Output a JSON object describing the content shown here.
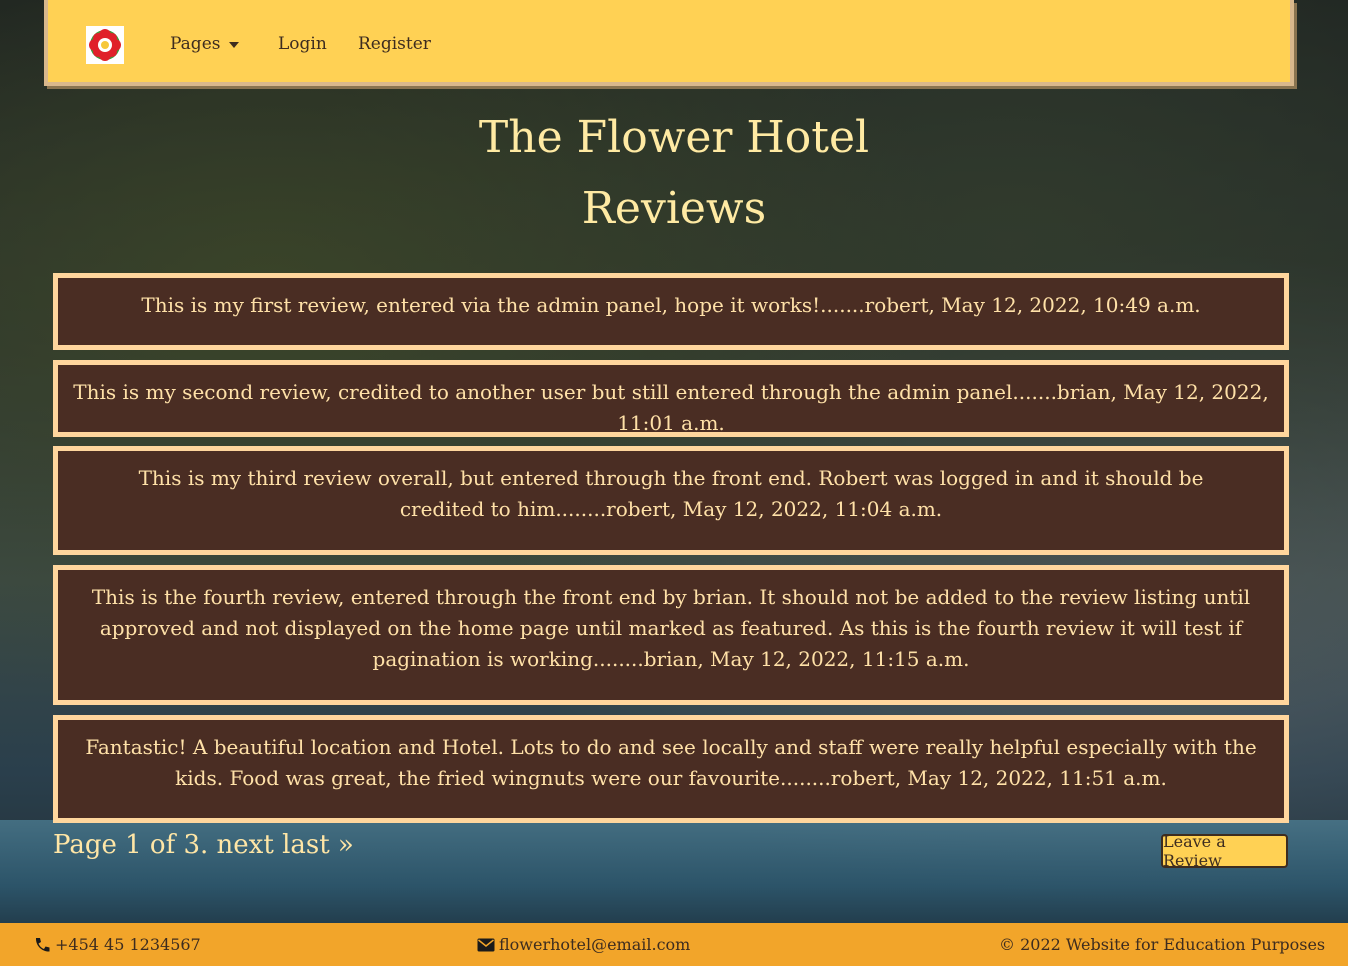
{
  "nav": {
    "pages_label": "Pages",
    "login_label": "Login",
    "register_label": "Register"
  },
  "header": {
    "title": "The Flower Hotel",
    "subtitle": "Reviews"
  },
  "reviews": [
    {
      "text": "This is my first review, entered via the admin panel, hope it works!.......robert, May 12, 2022, 10:49 a.m."
    },
    {
      "text": "This is my second review, credited to another user but still entered through the admin panel.......brian, May 12, 2022, 11:01 a.m."
    },
    {
      "text": "This is my third review overall, but entered through the front end. Robert was logged in and it should be credited to him........robert, May 12, 2022, 11:04 a.m."
    },
    {
      "text": "This is the fourth review, entered through the front end by brian. It should not be added to the review listing until approved and not displayed on the home page until marked as featured. As this is the fourth review it will test if pagination is working........brian, May 12, 2022, 11:15 a.m."
    },
    {
      "text": "Fantastic! A beautiful location and Hotel. Lots to do and see locally and staff were really helpful especially with the kids. Food was great, the fried wingnuts were our favourite........robert, May 12, 2022, 11:51 a.m."
    }
  ],
  "pagination": {
    "page_text": "Page 1 of 3.",
    "next_label": "next",
    "last_label": "last »"
  },
  "leave_review_label": "Leave a Review",
  "footer": {
    "phone": "+454 45 1234567",
    "email": "flowerhotel@email.com",
    "copyright": "© 2022 Website for Education Purposes"
  },
  "icons": {
    "logo": "flower-icon",
    "phone": "phone-icon",
    "email": "envelope-icon"
  },
  "colors": {
    "navbar": "#ffd154",
    "review_bg": "#4a2d23",
    "review_border": "#ffd69d",
    "footer": "#f2a52a",
    "title_text": "#ffeaa3"
  }
}
